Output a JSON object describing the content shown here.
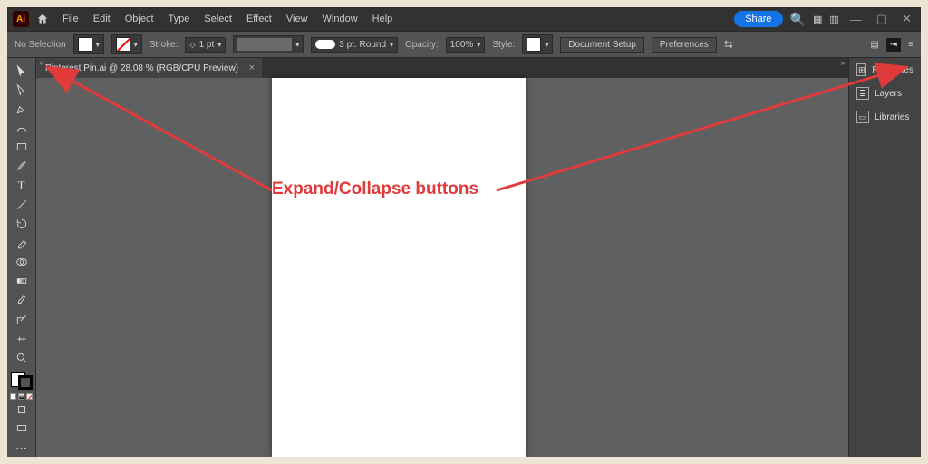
{
  "menubar": {
    "logo": "Ai",
    "items": [
      "File",
      "Edit",
      "Object",
      "Type",
      "Select",
      "Effect",
      "View",
      "Window",
      "Help"
    ],
    "share": "Share"
  },
  "controlbar": {
    "status": "No Selection",
    "stroke_label": "Stroke:",
    "stroke_pt": "1 pt",
    "brush_label": "3 pt. Round",
    "opacity_label": "Opacity:",
    "opacity_val": "100%",
    "style_label": "Style:",
    "doc_setup": "Document Setup",
    "prefs": "Preferences"
  },
  "tab": {
    "title": "Pinterest Pin.ai @ 28.08 % (RGB/CPU Preview)",
    "close": "×"
  },
  "panels": {
    "items": [
      {
        "icon": "⊞",
        "label": "Properties"
      },
      {
        "icon": "≣",
        "label": "Layers"
      },
      {
        "icon": "▭",
        "label": "Libraries"
      }
    ]
  },
  "annotation": "Expand/Collapse buttons",
  "toggle_glyph_left": "«",
  "toggle_glyph_right": "»"
}
